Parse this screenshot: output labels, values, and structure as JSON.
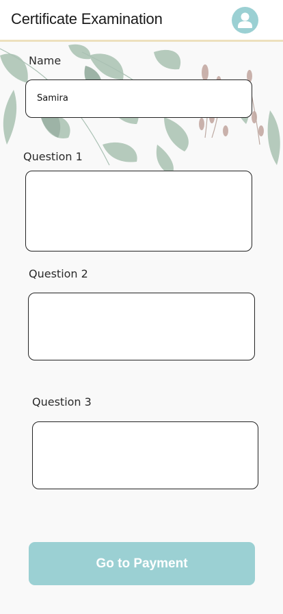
{
  "header": {
    "title": "Certificate Examination",
    "avatar_icon": "user-avatar-icon",
    "accent_color": "#9bd0d3",
    "divider_color": "#ede0bd"
  },
  "form": {
    "name_label": "Name",
    "name_value": "Samira",
    "question1_label": "Question 1",
    "question1_value": "",
    "question2_label": "Question 2",
    "question2_value": "",
    "question3_label": "Question 3",
    "question3_value": ""
  },
  "actions": {
    "pay_label": "Go to Payment",
    "pay_color": "#9bd0d3"
  }
}
